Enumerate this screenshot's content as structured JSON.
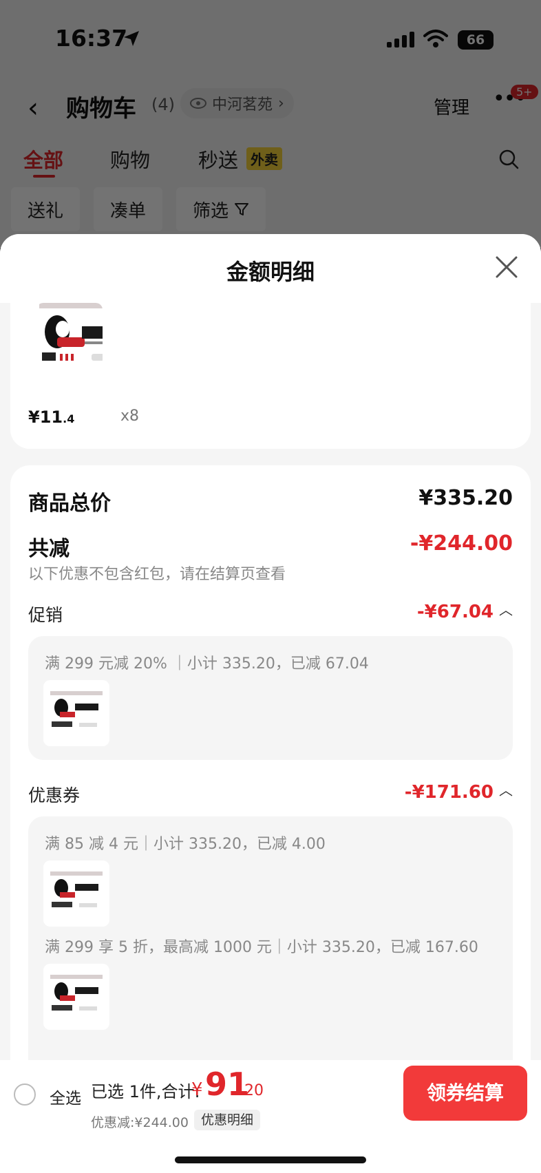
{
  "status_bar": {
    "time": "16:37",
    "battery": "66"
  },
  "nav": {
    "title": "购物车",
    "count": "(4)",
    "store": "中河茗苑",
    "manage": "管理",
    "badge": "5+"
  },
  "tabs": {
    "all": "全部",
    "shopping": "购物",
    "express": "秒送",
    "takeout_tag": "外卖"
  },
  "filters": {
    "gift": "送礼",
    "bundle": "凑单",
    "filter": "筛选"
  },
  "sheet": {
    "title": "金额明细",
    "item": {
      "price_main": "¥11",
      "price_decimal": ".4",
      "quantity": "x8"
    },
    "total_price_label": "商品总价",
    "total_price_value": "¥335.20",
    "total_discount_label": "共减",
    "total_discount_value": "-¥244.00",
    "discount_note": "以下优惠不包含红包，请在结算页查看",
    "promo": {
      "label": "促销",
      "value": "-¥67.04",
      "rule": "满 299 元减 20% ｜小计 335.20，已减 67.04"
    },
    "coupon": {
      "label": "优惠券",
      "value": "-¥171.60",
      "rule1": "满 85 减 4 元｜小计 335.20，已减 4.00",
      "rule2": "满 299 享 5 折，最高减 1000 元｜小计 335.20，已减 167.60"
    }
  },
  "bottom_bar": {
    "select_all": "全选",
    "selected_prefix": "已选 1件,合计:",
    "total_symbol": "¥",
    "total_integer": "91",
    "total_decimal": ".20",
    "saved": "优惠减:¥244.00",
    "detail_chip": "优惠明细",
    "checkout": "领券结算"
  },
  "colors": {
    "accent": "#e0262b",
    "takeout_tag": "#f6d23a",
    "checkout": "#f23a3a"
  },
  "icons": [
    "location-arrow-icon",
    "signal-icon",
    "wifi-icon",
    "back-icon",
    "eye-icon",
    "chevron-right-icon",
    "more-icon",
    "search-icon",
    "filter-funnel-icon",
    "close-icon",
    "chevron-up-icon",
    "product-thumbnail"
  ]
}
